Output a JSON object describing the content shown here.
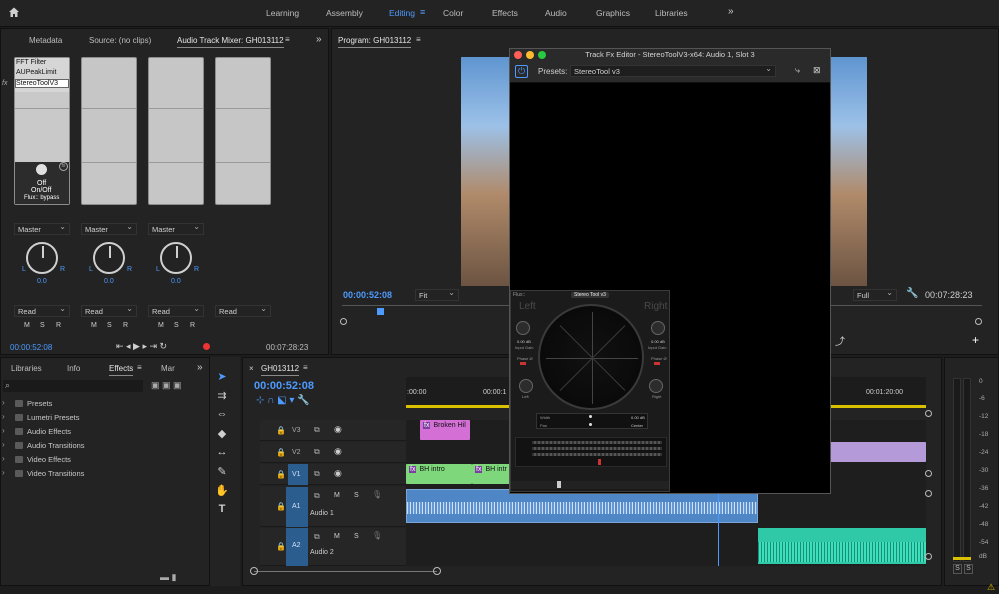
{
  "workspaces": [
    "Learning",
    "Assembly",
    "Editing",
    "Color",
    "Effects",
    "Audio",
    "Graphics",
    "Libraries"
  ],
  "active_workspace": "Editing",
  "source_panel": {
    "tabs": [
      "Metadata",
      "Source: (no clips)",
      "Audio Track Mixer: GH013112"
    ],
    "inserts": [
      "FFT Filter",
      "AUPeakLimit",
      "StereoToolV3"
    ],
    "flux": {
      "state1": "Off",
      "state2": "On/Off",
      "bypass": "Flux:: bypass"
    },
    "outputs": [
      "Master",
      "Master",
      "Master"
    ],
    "pan_values": [
      "0.0",
      "0.0",
      "0.0"
    ],
    "L": "L",
    "R": "R",
    "automation": [
      "Read",
      "Read",
      "Read",
      "Read"
    ],
    "msr": [
      "M",
      "S",
      "R"
    ],
    "timecode_left": "00:00:52:08",
    "timecode_right": "00:07:28:23"
  },
  "program": {
    "title": "Program: GH013112",
    "timecode": "00:00:52:08",
    "fit": "Fit",
    "quality": "Full",
    "duration": "00:07:28:23"
  },
  "fx_editor": {
    "title": "Track Fx Editor - StereoToolV3-x64: Audio 1, Slot 3",
    "presets_label": "Presets:",
    "preset_value": "StereoTool v3",
    "plugin": {
      "brand": "Flux::",
      "name": "Stereo Tool v3",
      "left": "Left",
      "right": "Right",
      "input_gain_l": "Input Gain",
      "input_gain_r": "Input Gain",
      "gain_l_val": "0.00 dB",
      "gain_r_val": "0.00 dB",
      "phase_l": "Phase Ø",
      "phase_r": "Phase Ø",
      "sub_l": "Left",
      "sub_r": "Right",
      "width": "Width",
      "width_val": "0.00 dB",
      "pan": "Pan",
      "pan_val": "Center"
    }
  },
  "effects_panel": {
    "tabs": [
      "Libraries",
      "Info",
      "Effects",
      "Mar"
    ],
    "items": [
      "Presets",
      "Lumetri Presets",
      "Audio Effects",
      "Audio Transitions",
      "Video Effects",
      "Video Transitions"
    ]
  },
  "timeline": {
    "title": "GH013112",
    "timecode": "00:00:52:08",
    "ruler": [
      ":00:00",
      "00:00:1",
      "00:01:20:00"
    ],
    "tracks": [
      {
        "id": "V3",
        "label": ""
      },
      {
        "id": "V2",
        "label": ""
      },
      {
        "id": "V1",
        "label": ""
      },
      {
        "id": "A1",
        "label": "Audio 1"
      },
      {
        "id": "A2",
        "label": "Audio 2"
      }
    ],
    "clips": {
      "v3": "Broken Hil",
      "v1a": "BH intro",
      "v1b": "BH intr"
    },
    "fx_badge": "fx"
  },
  "meter": {
    "scale": [
      "0",
      "-6",
      "-12",
      "-18",
      "-24",
      "-30",
      "-36",
      "-42",
      "-48",
      "-54",
      "dB"
    ],
    "solo": [
      "S",
      "S"
    ]
  }
}
